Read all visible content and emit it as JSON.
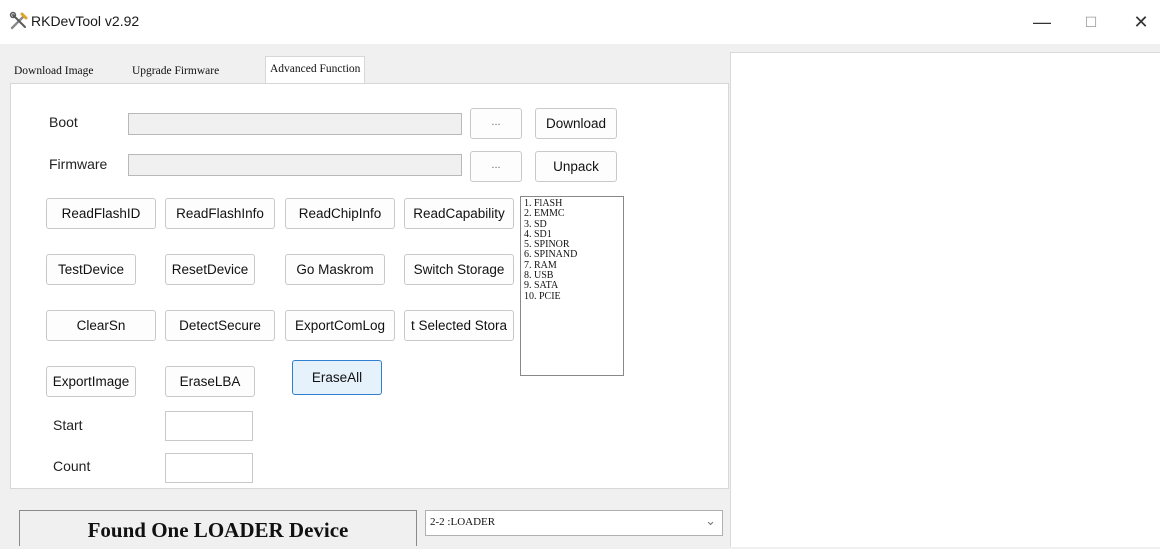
{
  "window": {
    "title": "RKDevTool v2.92",
    "minimize_glyph": "—",
    "maximize_glyph": "☐",
    "close_glyph": "✕",
    "icon": "rk-tools-icon"
  },
  "tabs": [
    {
      "label": "Download Image"
    },
    {
      "label": "Upgrade Firmware"
    },
    {
      "label": "Advanced Function",
      "active": true
    }
  ],
  "advanced": {
    "boot_label": "Boot",
    "firmware_label": "Firmware",
    "browse_label": "...",
    "download_label": "Download",
    "unpack_label": "Unpack",
    "buttons": {
      "read_flash_id": "ReadFlashID",
      "read_flash_info": "ReadFlashInfo",
      "read_chip_info": "ReadChipInfo",
      "read_capability": "ReadCapability",
      "test_device": "TestDevice",
      "reset_device": "ResetDevice",
      "go_maskrom": "Go Maskrom",
      "switch_storage": "Switch Storage",
      "clear_sn": "ClearSn",
      "detect_secure": "DetectSecure",
      "export_com_log": "ExportComLog",
      "select_storage": "t Selected Stora",
      "export_image": "ExportImage",
      "erase_lba": "EraseLBA",
      "erase_all": "EraseAll"
    },
    "storage_list": [
      "1.  FlASH",
      "2.  EMMC",
      "3.  SD",
      "4.  SD1",
      "5.  SPINOR",
      "6.  SPINAND",
      "7.  RAM",
      "8.  USB",
      "9.  SATA",
      "10.  PCIE"
    ],
    "start_label": "Start",
    "count_label": "Count",
    "start_value": "",
    "count_value": ""
  },
  "status": {
    "message": "Found One LOADER Device",
    "device_selected": "2-2 :LOADER",
    "dropdown_icon": "chevron-down-icon"
  },
  "log": {
    "text": ""
  }
}
